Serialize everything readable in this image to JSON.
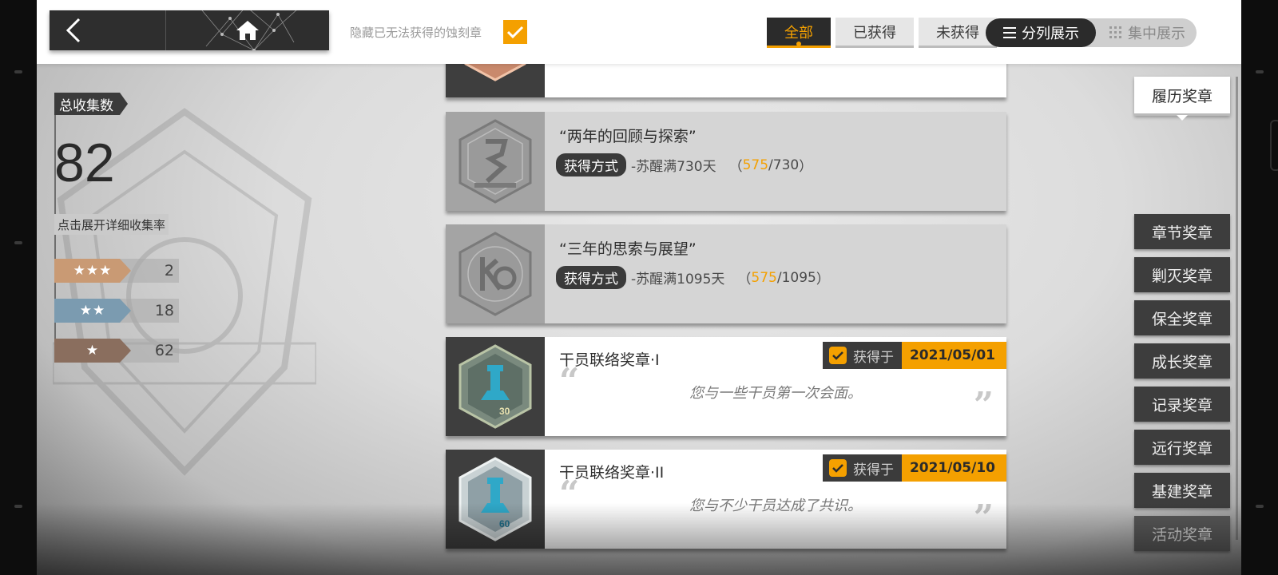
{
  "topbar": {
    "hide_unobtainable_label": "隐藏已无法获得的蚀刻章",
    "hide_unobtainable_checked": true,
    "filters": [
      "全部",
      "已获得",
      "未获得"
    ],
    "active_filter": "全部",
    "view_modes": {
      "list": "分列展示",
      "grid": "集中展示"
    },
    "active_view": "分列展示",
    "icons": {
      "back": "back-arrow-icon",
      "home": "home-icon",
      "check": "check-icon",
      "list": "list-icon",
      "grid": "grid-dots-icon"
    }
  },
  "stats": {
    "label": "总收集数",
    "total": "82",
    "expand_label": "点击展开详细收集率",
    "rarities": [
      {
        "stars": "★★★",
        "count": "2",
        "color": "#c99a74"
      },
      {
        "stars": "★★",
        "count": "18",
        "color": "#7b9bb0"
      },
      {
        "stars": "★",
        "count": "62",
        "color": "#8a6e5e"
      }
    ]
  },
  "medals": [
    {
      "state": "locked",
      "title": "“两年的回顾与探索”",
      "method_tag": "获得方式",
      "method_text": "-苏醒满730天",
      "progress_current": "575",
      "progress_total": "/730",
      "icon": "second-year-medal-icon"
    },
    {
      "state": "locked",
      "title": "“三年的思索与展望”",
      "method_tag": "获得方式",
      "method_text": "-苏醒满1095天",
      "progress_current": "575",
      "progress_total": "/1095",
      "icon": "third-year-medal-icon"
    },
    {
      "state": "owned",
      "title": "干员联络奖章·I",
      "obtained_label": "获得于",
      "obtained_date": "2021/05/01",
      "description": "您与一些干员第一次会面。",
      "medal_number": "30",
      "icon": "recruitment-30-medal-icon"
    },
    {
      "state": "owned",
      "title": "干员联络奖章·II",
      "obtained_label": "获得于",
      "obtained_date": "2021/05/10",
      "description": "您与不少干员达成了共识。",
      "medal_number": "60",
      "icon": "recruitment-60-medal-icon"
    }
  ],
  "categories": {
    "active": "履历奖章",
    "items": [
      "章节奖章",
      "剿灭奖章",
      "保全奖章",
      "成长奖章",
      "记录奖章",
      "远行奖章",
      "基建奖章",
      "活动奖章"
    ]
  },
  "colors": {
    "accent": "#f4a000",
    "dark": "#2b2b2b"
  }
}
